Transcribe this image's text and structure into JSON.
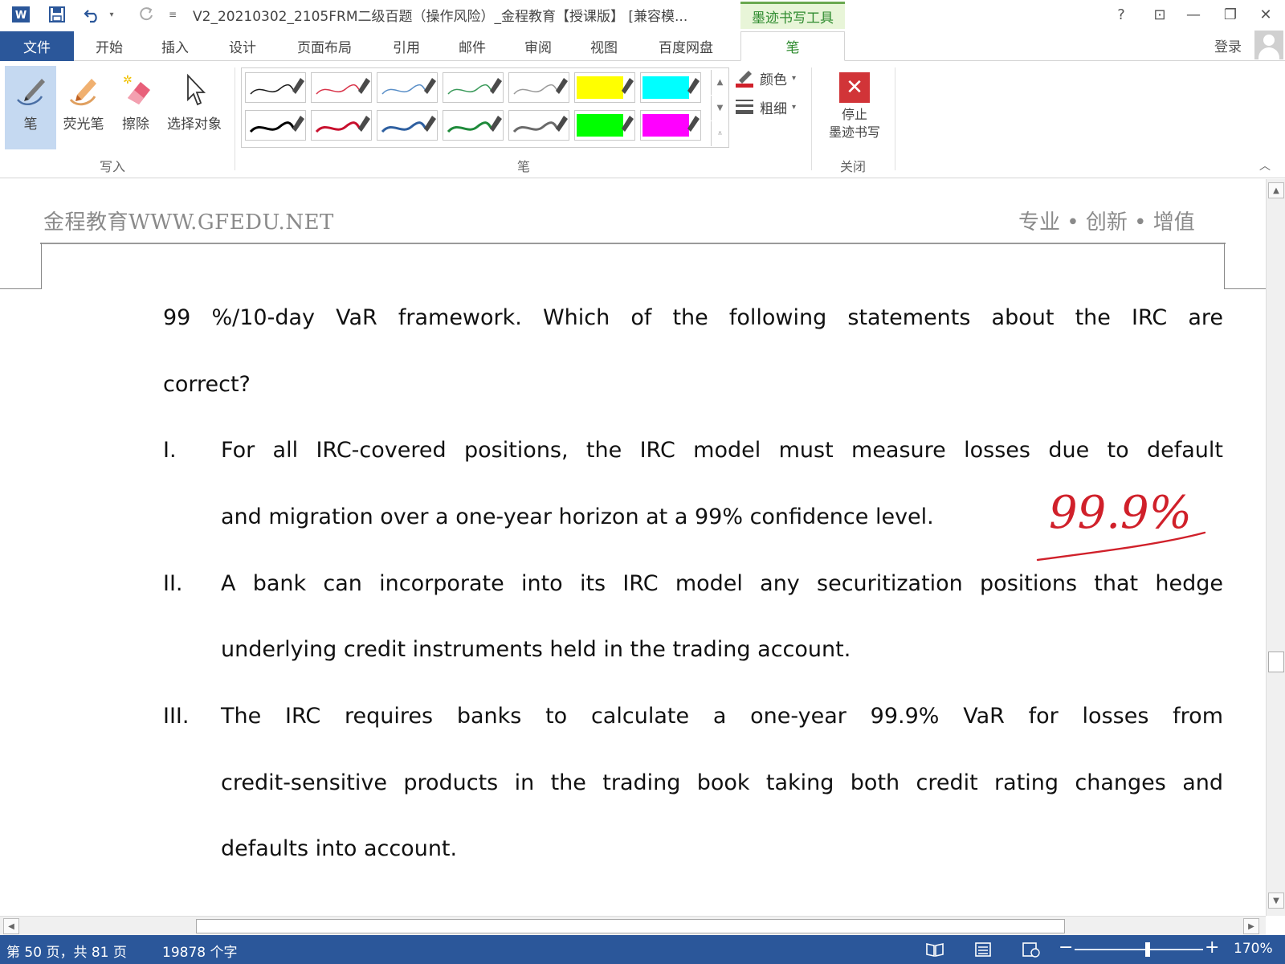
{
  "titlebar": {
    "doc_title": "V2_20210302_2105FRM二级百题（操作风险）_金程教育【授课版】 [兼容模...",
    "contextual_tab": "墨迹书写工具",
    "help": "?",
    "ribbon_display": "⊡",
    "minimize": "—",
    "restore": "❐",
    "close": "✕"
  },
  "tabs": {
    "file": "文件",
    "items": [
      "开始",
      "插入",
      "设计",
      "页面布局",
      "引用",
      "邮件",
      "审阅",
      "视图",
      "百度网盘",
      "笔"
    ],
    "active": "笔",
    "login": "登录"
  },
  "ribbon": {
    "write_group": {
      "label": "写入",
      "buttons": [
        {
          "label": "笔",
          "icon": "pen-icon"
        },
        {
          "label": "荧光笔",
          "icon": "highlighter-icon"
        },
        {
          "label": "擦除",
          "icon": "eraser-icon"
        },
        {
          "label": "选择对象",
          "icon": "select-cursor-icon"
        }
      ]
    },
    "pens_group": {
      "label": "笔",
      "row1_colors": [
        "#1a1a1a",
        "#d9344a",
        "#5a8fc8",
        "#3a9a5a",
        "#9a9a9a",
        "#ffff00",
        "#00ffff"
      ],
      "row2_colors": [
        "#000000",
        "#c8102e",
        "#2e5fa0",
        "#1e8a3a",
        "#6a6a6a",
        "#00ff00",
        "#ff00ff"
      ],
      "color_label": "颜色",
      "thickness_label": "粗细"
    },
    "close_group": {
      "label": "关闭",
      "stop_line1": "停止",
      "stop_line2": "墨迹书写"
    }
  },
  "document": {
    "header_left": "金程教育WWW.GFEDU.NET",
    "header_right": "专业 • 创新 • 增值",
    "intro_line1": "99 %/10-day VaR framework. Which of the following statements about the IRC are",
    "intro_line2": "correct?",
    "items": [
      {
        "num": "I.",
        "lines": [
          "For all IRC-covered positions, the IRC model must measure losses due to default",
          "and migration over a one-year horizon at a 99% confidence level."
        ]
      },
      {
        "num": "II.",
        "lines": [
          "A bank can incorporate into its IRC model any securitization positions that hedge",
          "underlying credit instruments held in the trading account."
        ]
      },
      {
        "num": "III.",
        "lines": [
          "The IRC requires banks to calculate a one-year 99.9% VaR for losses from",
          "credit-sensitive products in the trading book taking both credit rating changes and",
          "defaults into account."
        ]
      }
    ],
    "ink_annotation": "99.9%",
    "ink_color": "#d0202a"
  },
  "statusbar": {
    "page_info": "第 50 页，共 81 页",
    "word_count": "19878 个字",
    "zoom_out": "−",
    "zoom_in": "+",
    "zoom_level": "170%"
  },
  "colors": {
    "accent": "#2b579a",
    "ink_tab_green": "#2e8b2e"
  }
}
